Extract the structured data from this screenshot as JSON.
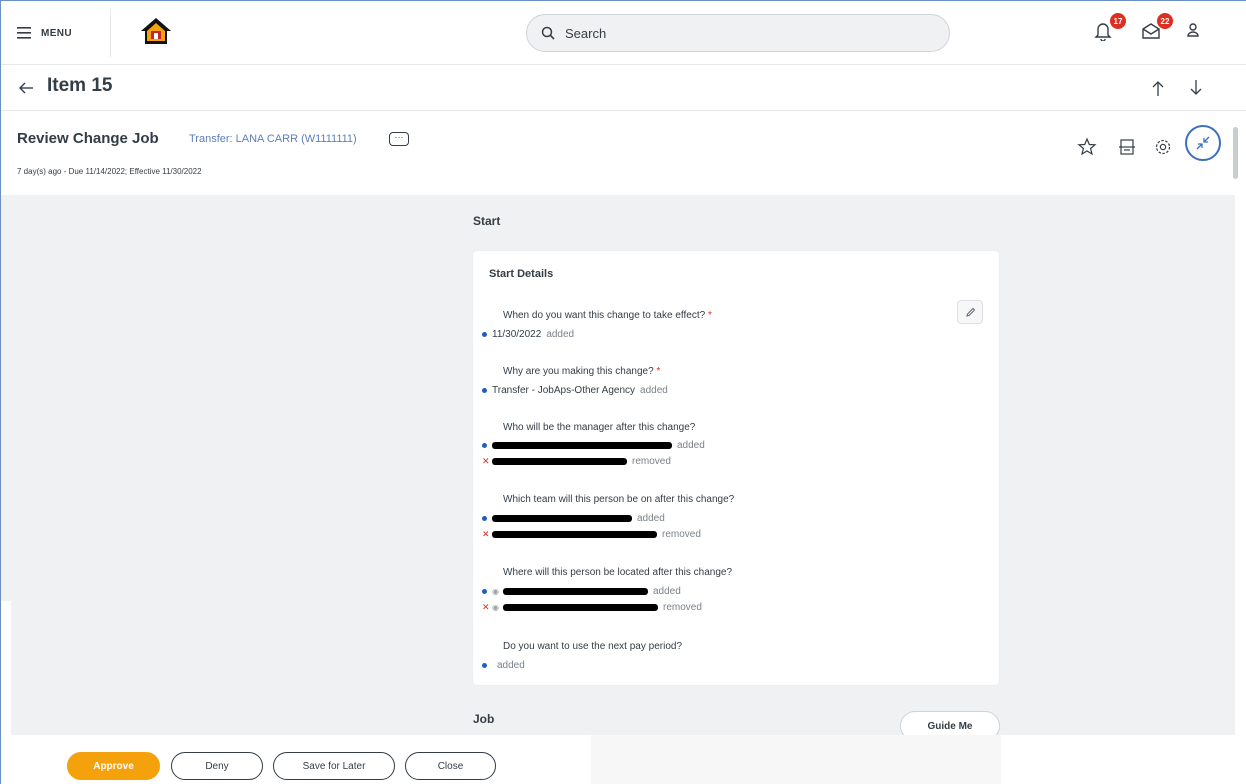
{
  "topbar": {
    "menu_label": "MENU",
    "search_placeholder": "Search",
    "notifications_count": "17",
    "inbox_count": "22"
  },
  "item": {
    "title": "Item 15"
  },
  "task": {
    "title": "Review Change Job",
    "subtitle": "Transfer: LANA CARR (W1111111)",
    "more_label": "···",
    "meta": "7 day(s) ago - Due 11/14/2022; Effective 11/30/2022"
  },
  "sections": {
    "start": "Start",
    "job": "Job"
  },
  "card": {
    "title": "Start Details",
    "questions": [
      {
        "q": "When do you want this change to take effect?",
        "required": "*",
        "answers": [
          {
            "text": "11/30/2022",
            "tag": "added"
          }
        ]
      },
      {
        "q": "Why are you making this change?",
        "required": "*",
        "answers": [
          {
            "text": "Transfer - JobAps-Other Agency",
            "tag": "added"
          }
        ]
      },
      {
        "q": "Who will be the manager after this change?",
        "answers": [
          {
            "tag": "added"
          },
          {
            "tag": "removed"
          }
        ]
      },
      {
        "q": "Which team will this person be on after this change?",
        "answers": [
          {
            "tag": "added"
          },
          {
            "tag": "removed"
          }
        ]
      },
      {
        "q": "Where will this person be located after this change?",
        "answers": [
          {
            "tag": "added"
          },
          {
            "tag": "removed"
          }
        ]
      },
      {
        "q": "Do you want to use the next pay period?",
        "answers": [
          {
            "tag": "added"
          }
        ]
      }
    ]
  },
  "guide_me": "Guide Me",
  "actions": {
    "approve": "Approve",
    "deny": "Deny",
    "save_for_later": "Save for Later",
    "close": "Close"
  },
  "colors": {
    "primary_action": "#f5a10c",
    "link": "#5b7fbd",
    "badge": "#de2e21",
    "added_dot": "#1f5fbf"
  }
}
